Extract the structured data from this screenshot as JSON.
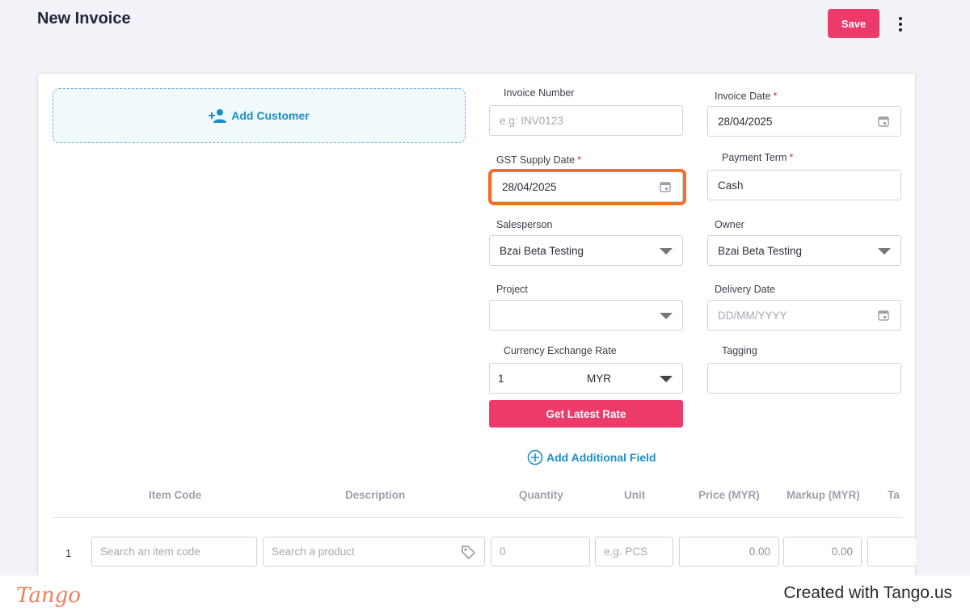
{
  "header": {
    "title": "New Invoice",
    "save_label": "Save"
  },
  "customer": {
    "add_label": "Add Customer"
  },
  "form": {
    "invoice_number": {
      "label": "Invoice Number",
      "placeholder": "e.g: INV0123"
    },
    "invoice_date": {
      "label": "Invoice Date",
      "required": "*",
      "value": "28/04/2025"
    },
    "gst_supply_date": {
      "label": "GST Supply Date",
      "required": "*",
      "value": "28/04/2025"
    },
    "payment_term": {
      "label": "Payment Term",
      "required": "*",
      "value": "Cash"
    },
    "salesperson": {
      "label": "Salesperson",
      "value": "Bzai Beta Testing"
    },
    "owner": {
      "label": "Owner",
      "value": "Bzai Beta Testing"
    },
    "project": {
      "label": "Project",
      "value": ""
    },
    "delivery_date": {
      "label": "Delivery Date",
      "placeholder": "DD/MM/YYYY"
    },
    "currency_exchange_rate": {
      "label": "Currency Exchange Rate",
      "rate": "1",
      "currency": "MYR"
    },
    "tagging": {
      "label": "Tagging",
      "value": ""
    },
    "get_latest_rate_label": "Get Latest Rate",
    "add_additional_field_label": "Add Additional Field"
  },
  "items_table": {
    "headers": [
      "Item Code",
      "Description",
      "Quantity",
      "Unit",
      "Price (MYR)",
      "Markup (MYR)",
      "Ta"
    ],
    "rows": [
      {
        "number": "1",
        "item_code_placeholder": "Search an item code",
        "description_placeholder": "Search a product",
        "quantity_placeholder": "0",
        "unit_placeholder": "e.g. PCS",
        "price_placeholder": "0.00",
        "markup_placeholder": "0.00"
      }
    ]
  },
  "footer": {
    "logo": "Tango",
    "credit": "Created with Tango.us"
  },
  "colors": {
    "accent_pink": "#ec3a6a",
    "link_blue": "#1d8ec7",
    "highlight_orange": "#f06f2b",
    "tango_orange": "#f07d5c"
  }
}
